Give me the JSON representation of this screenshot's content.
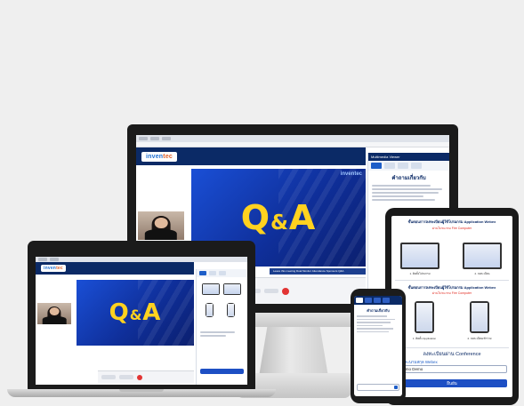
{
  "monitor": {
    "browser_tabs": [
      "",
      "",
      ""
    ],
    "app_logo": {
      "part1": "inven",
      "part2": "tec"
    },
    "header_text": "",
    "qa": {
      "q": "Q",
      "amp": "&",
      "a": "A",
      "brand": "inventec"
    },
    "side_panel": {
      "title": "Multimedia Viewer",
      "heading": "คำถามเกี่ยวกับ"
    },
    "ticker": "Leave this meeting   Dual Monitor   Attendance   Sponsors   Q&A"
  },
  "laptop": {
    "app_logo": {
      "part1": "inven",
      "part2": "tec"
    },
    "qa": {
      "q": "Q",
      "amp": "&",
      "a": "A"
    }
  },
  "tablet": {
    "section1_title": "ขั้นตอนการลงทะเบียนผู้ใช้โปรแกรม Application Webex",
    "section1_sub": "ผ่านโปรแกรม Fire Computer",
    "section2_title": "ขั้นตอนการลงทะเบียนผู้ใช้โปรแกรม Application Webex",
    "section2_sub": "ผ่านโปรแกรม Fire Computer",
    "caption1": "1. ติดตั้งโปรแกรม",
    "caption2": "2. ลงทะเบียน",
    "caption3": "1. ติดตั้ง Application",
    "caption4": "2. ลงทะเบียนเข้าร่วม",
    "form_label": "ลงทะเบียนผ่าน Conference",
    "field_label": "ชื่อและนามสกุล Webex",
    "field_value": "Demo Demo",
    "submit": "ยืนยัน"
  },
  "phone": {
    "heading": "คำถามเกี่ยวกับ"
  }
}
